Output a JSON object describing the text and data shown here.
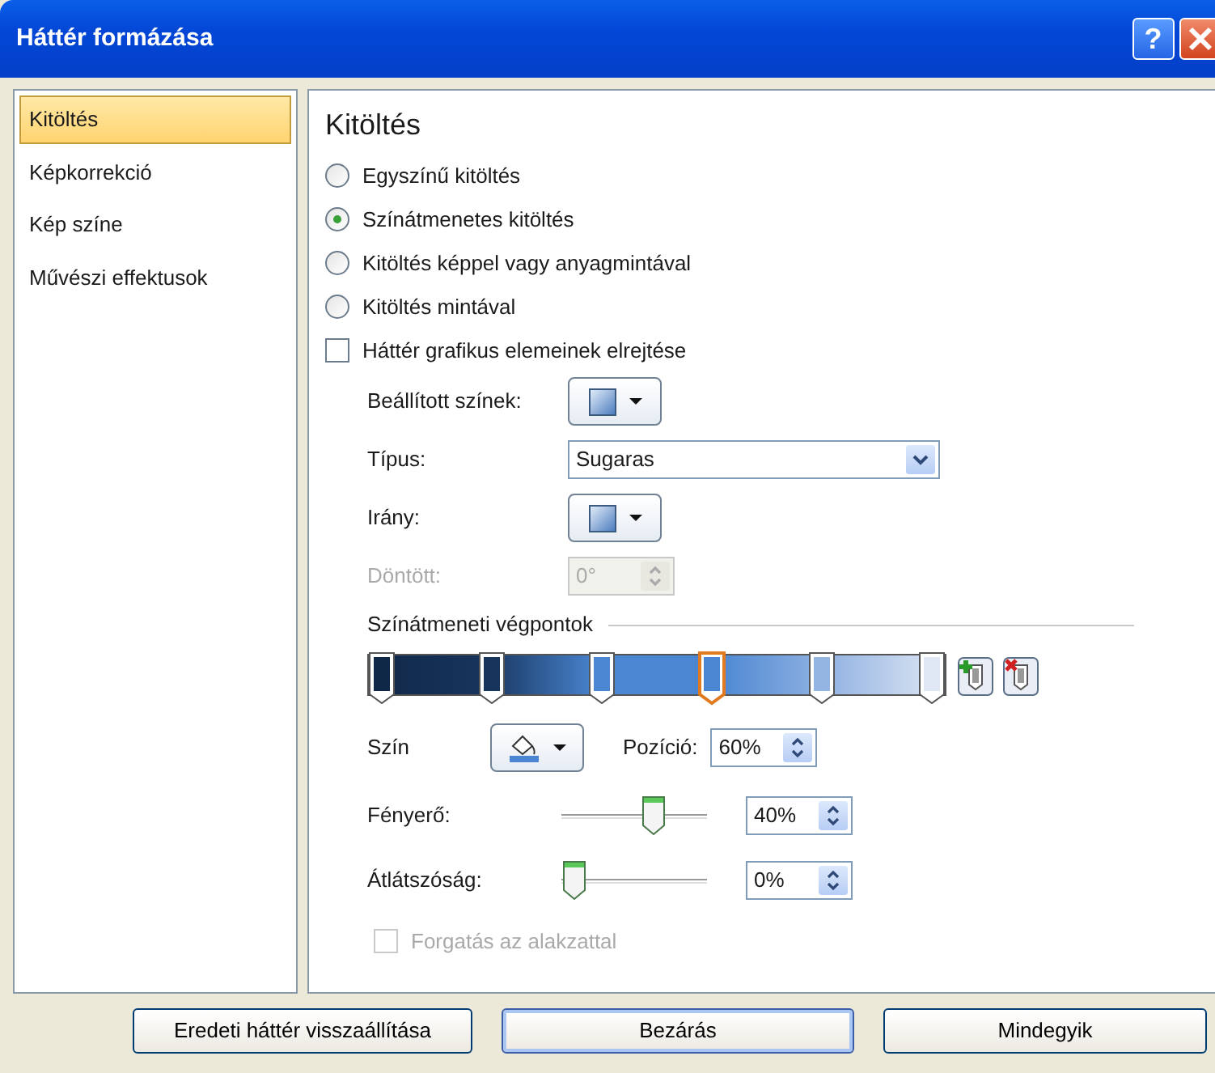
{
  "window": {
    "title": "Háttér formázása",
    "help": "?"
  },
  "sidebar": {
    "items": [
      {
        "label": "Kitöltés",
        "selected": true
      },
      {
        "label": "Képkorrekció",
        "selected": false
      },
      {
        "label": "Kép színe",
        "selected": false
      },
      {
        "label": "Művészi effektusok",
        "selected": false
      }
    ]
  },
  "panel": {
    "heading": "Kitöltés",
    "fill_options": [
      {
        "label": "Egyszínű kitöltés",
        "selected": false
      },
      {
        "label": "Színátmenetes kitöltés",
        "selected": true
      },
      {
        "label": "Kitöltés képpel vagy anyagmintával",
        "selected": false
      },
      {
        "label": "Kitöltés mintával",
        "selected": false
      }
    ],
    "hide_graphics": {
      "label": "Háttér grafikus elemeinek elrejtése",
      "checked": false
    },
    "preset_colors": {
      "label": "Beállított színek:"
    },
    "type": {
      "label": "Típus:",
      "value": "Sugaras"
    },
    "direction": {
      "label": "Irány:"
    },
    "angle": {
      "label": "Döntött:",
      "value": "0°",
      "disabled": true
    },
    "stops_section": {
      "title": "Színátmeneti végpontok",
      "stops": [
        {
          "level": 0,
          "color": "#102848",
          "selected": false
        },
        {
          "level": 0.2,
          "color": "#17345c",
          "selected": false
        },
        {
          "level": 0.4,
          "color": "#4a86d2",
          "selected": false
        },
        {
          "level": 0.6,
          "color": "#4a86d2",
          "selected": true
        },
        {
          "level": 0.8,
          "color": "#94b4e2",
          "selected": false
        },
        {
          "level": 1,
          "color": "#dfe7f4",
          "selected": false
        }
      ]
    },
    "color": {
      "label": "Szín"
    },
    "position": {
      "label": "Pozíció:",
      "value": "60%"
    },
    "brightness": {
      "label": "Fényerő:",
      "level": 0.66,
      "value": "40%"
    },
    "transparency": {
      "label": "Átlátszóság:",
      "level": 0,
      "value": "0%"
    },
    "rotate": {
      "label": "Forgatás az alakzattal",
      "checked": false,
      "disabled": true
    }
  },
  "buttons": [
    {
      "label": "Eredeti háttér visszaállítása",
      "default": false
    },
    {
      "label": "Bezárás",
      "default": true
    },
    {
      "label": "Mindegyik",
      "default": false
    }
  ]
}
